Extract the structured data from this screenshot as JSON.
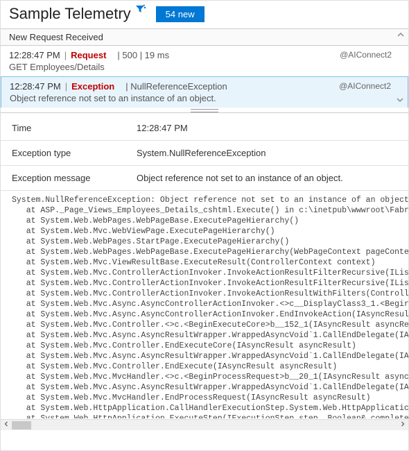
{
  "header": {
    "title": "Sample Telemetry",
    "new_badge": "54 new"
  },
  "banner": {
    "text": "New Request Received"
  },
  "events": [
    {
      "time": "12:28:47 PM",
      "kind": "Request",
      "meta": "| 500 | 19 ms",
      "source": "@AIConnect2",
      "line2": "GET Employees/Details",
      "selected": false
    },
    {
      "time": "12:28:47 PM",
      "kind": "Exception",
      "meta": "| NullReferenceException",
      "source": "@AIConnect2",
      "line2": "Object reference not set to an instance of an object.",
      "selected": true
    }
  ],
  "details": {
    "rows": [
      {
        "label": "Time",
        "value": "12:28:47 PM"
      },
      {
        "label": "Exception type",
        "value": "System.NullReferenceException"
      },
      {
        "label": "Exception message",
        "value": "Object reference not set to an instance of an object."
      }
    ],
    "stack": "System.NullReferenceException: Object reference not set to an instance of an object\n   at ASP._Page_Views_Employees_Details_cshtml.Execute() in c:\\inetpub\\wwwroot\\Fabr\n   at System.Web.WebPages.WebPageBase.ExecutePageHierarchy()\n   at System.Web.Mvc.WebViewPage.ExecutePageHierarchy()\n   at System.Web.WebPages.StartPage.ExecutePageHierarchy()\n   at System.Web.WebPages.WebPageBase.ExecutePageHierarchy(WebPageContext pageConte\n   at System.Web.Mvc.ViewResultBase.ExecuteResult(ControllerContext context)\n   at System.Web.Mvc.ControllerActionInvoker.InvokeActionResultFilterRecursive(ILis\n   at System.Web.Mvc.ControllerActionInvoker.InvokeActionResultFilterRecursive(ILis\n   at System.Web.Mvc.ControllerActionInvoker.InvokeActionResultWithFilters(Controll\n   at System.Web.Mvc.Async.AsyncControllerActionInvoker.<>c__DisplayClass3_1.<Begir\n   at System.Web.Mvc.Async.AsyncControllerActionInvoker.EndInvokeAction(IAsyncResul\n   at System.Web.Mvc.Controller.<>c.<BeginExecuteCore>b__152_1(IAsyncResult asyncRe\n   at System.Web.Mvc.Async.AsyncResultWrapper.WrappedAsyncVoid`1.CallEndDelegate(IA\n   at System.Web.Mvc.Controller.EndExecuteCore(IAsyncResult asyncResult)\n   at System.Web.Mvc.Async.AsyncResultWrapper.WrappedAsyncVoid`1.CallEndDelegate(IA\n   at System.Web.Mvc.Controller.EndExecute(IAsyncResult asyncResult)\n   at System.Web.Mvc.MvcHandler.<>c.<BeginProcessRequest>b__20_1(IAsyncResult async\n   at System.Web.Mvc.Async.AsyncResultWrapper.WrappedAsyncVoid`1.CallEndDelegate(IA\n   at System.Web.Mvc.MvcHandler.EndProcessRequest(IAsyncResult asyncResult)\n   at System.Web.HttpApplication.CallHandlerExecutionStep.System.Web.HttpApplicatic\n   at System.Web.HttpApplication.ExecuteStep(IExecutionStep step, Boolean& complete"
  }
}
